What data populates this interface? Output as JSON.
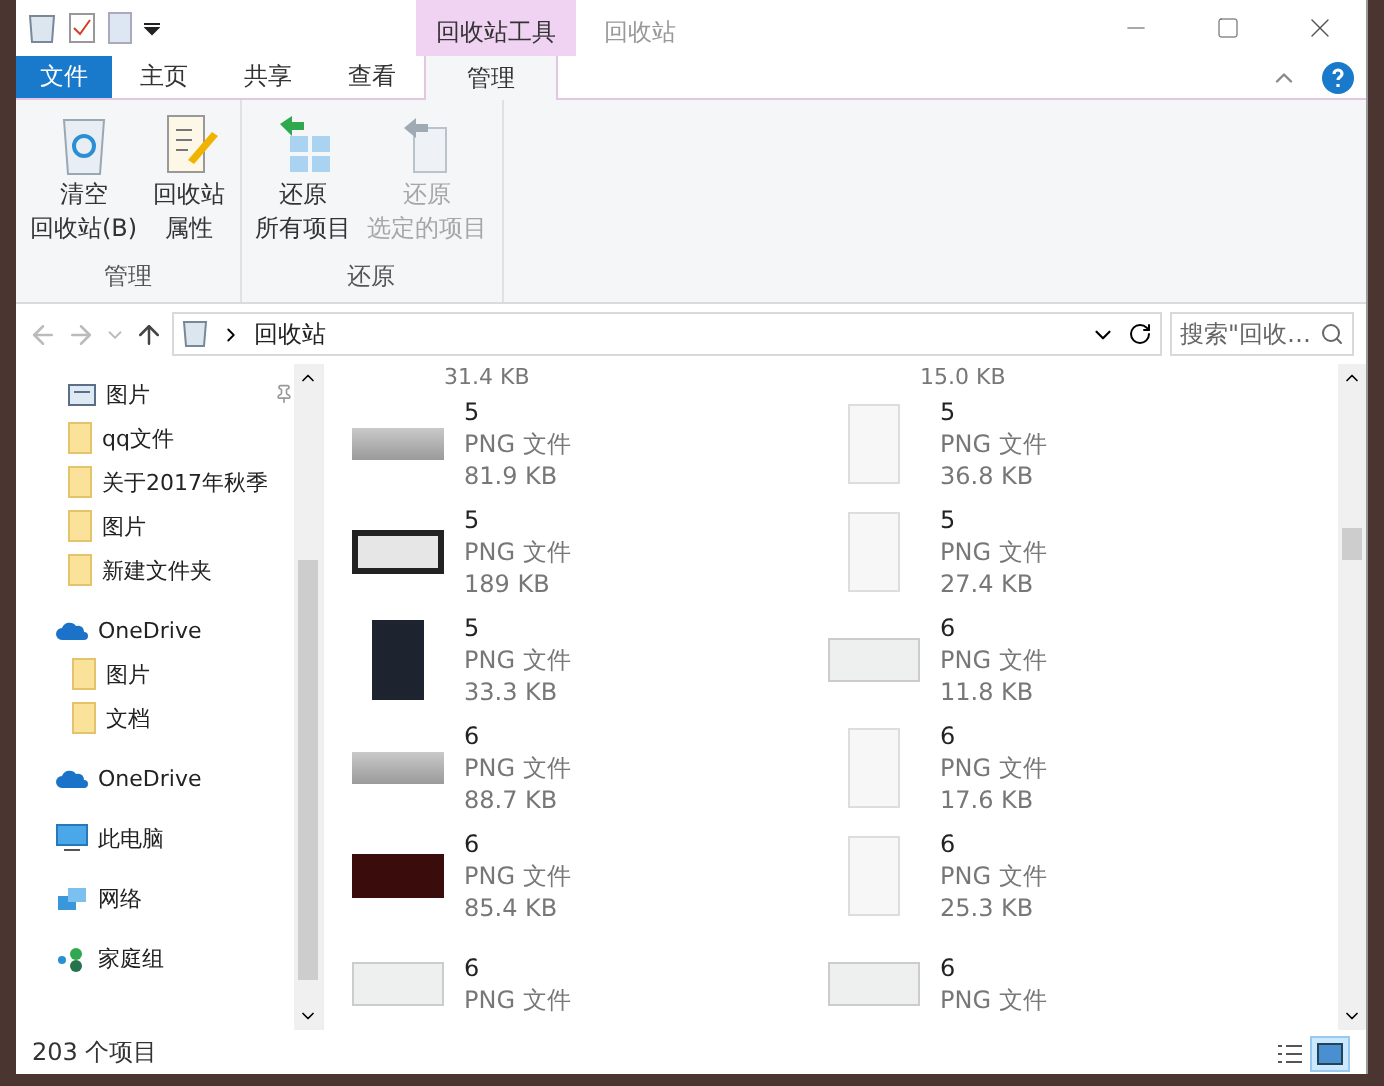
{
  "title_bar": {
    "contextual_tab": "回收站工具",
    "title": "回收站"
  },
  "ribbon_tabs": [
    {
      "label": "文件",
      "kind": "file",
      "selected": false
    },
    {
      "label": "主页",
      "kind": "tab",
      "selected": false
    },
    {
      "label": "共享",
      "kind": "tab",
      "selected": false
    },
    {
      "label": "查看",
      "kind": "tab",
      "selected": false
    },
    {
      "label": "管理",
      "kind": "contextual",
      "selected": true
    }
  ],
  "ribbon_groups": [
    {
      "label": "管理",
      "commands": [
        {
          "lines": [
            "清空",
            "回收站(B)"
          ],
          "kind": "empty-bin",
          "disabled": false
        },
        {
          "lines": [
            "回收站",
            "属性"
          ],
          "kind": "properties",
          "disabled": false
        }
      ]
    },
    {
      "label": "还原",
      "commands": [
        {
          "lines": [
            "还原",
            "所有项目"
          ],
          "kind": "restore-all",
          "disabled": false
        },
        {
          "lines": [
            "还原",
            "选定的项目"
          ],
          "kind": "restore-selected",
          "disabled": true
        }
      ]
    }
  ],
  "address_bar": {
    "path": "回收站"
  },
  "search": {
    "placeholder": "搜索\"回收…"
  },
  "navigation": {
    "quick_access": [
      {
        "label": "图片",
        "kind": "pictures",
        "pinned": true
      },
      {
        "label": "qq文件",
        "kind": "folder",
        "pinned": false
      },
      {
        "label": "关于2017年秋季",
        "kind": "folder",
        "pinned": false
      },
      {
        "label": "图片",
        "kind": "folder",
        "pinned": false
      },
      {
        "label": "新建文件夹",
        "kind": "folder",
        "pinned": false
      }
    ],
    "locations": [
      {
        "label": "OneDrive",
        "kind": "onedrive",
        "children": [
          {
            "label": "图片",
            "kind": "folder"
          },
          {
            "label": "文档",
            "kind": "folder"
          }
        ]
      },
      {
        "label": "OneDrive",
        "kind": "onedrive"
      },
      {
        "label": "此电脑",
        "kind": "pc"
      },
      {
        "label": "网络",
        "kind": "network"
      },
      {
        "label": "家庭组",
        "kind": "homegroup"
      }
    ]
  },
  "files": {
    "partial_sizes": [
      "31.4 KB",
      "15.0 KB"
    ],
    "items": [
      {
        "name": "5",
        "type": "PNG 文件",
        "size": "81.9 KB",
        "kind": "landscape"
      },
      {
        "name": "5",
        "type": "PNG 文件",
        "size": "36.8 KB",
        "kind": "portrait"
      },
      {
        "name": "5",
        "type": "PNG 文件",
        "size": "189 KB",
        "kind": "dark-frame"
      },
      {
        "name": "5",
        "type": "PNG 文件",
        "size": "27.4 KB",
        "kind": "portrait"
      },
      {
        "name": "5",
        "type": "PNG 文件",
        "size": "33.3 KB",
        "kind": "dark-portrait"
      },
      {
        "name": "6",
        "type": "PNG 文件",
        "size": "11.8 KB",
        "kind": "landscape-light"
      },
      {
        "name": "6",
        "type": "PNG 文件",
        "size": "88.7 KB",
        "kind": "landscape"
      },
      {
        "name": "6",
        "type": "PNG 文件",
        "size": "17.6 KB",
        "kind": "portrait"
      },
      {
        "name": "6",
        "type": "PNG 文件",
        "size": "85.4 KB",
        "kind": "dark-red"
      },
      {
        "name": "6",
        "type": "PNG 文件",
        "size": "25.3 KB",
        "kind": "portrait"
      },
      {
        "name": "6",
        "type": "PNG 文件",
        "kind": "landscape-light"
      },
      {
        "name": "6",
        "type": "PNG 文件",
        "kind": "landscape-light"
      }
    ]
  },
  "status_bar": {
    "count": "203 个项目",
    "views": [
      {
        "kind": "details",
        "selected": false
      },
      {
        "kind": "thumbnails",
        "selected": true
      }
    ]
  }
}
